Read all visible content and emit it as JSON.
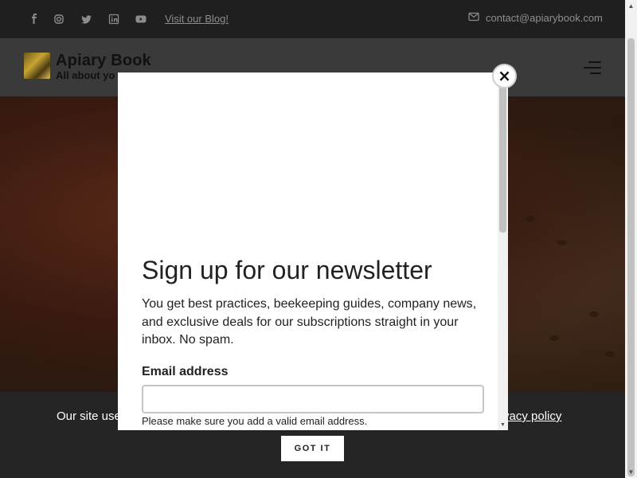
{
  "topbar": {
    "social_icons": [
      "facebook-icon",
      "instagram-icon",
      "twitter-icon",
      "linkedin-icon",
      "youtube-icon"
    ],
    "blog_link": "Visit our Blog!",
    "contact_email": "contact@apiarybook.com"
  },
  "header": {
    "logo_title": "Apiary Book",
    "logo_tagline": "All about yo"
  },
  "modal": {
    "title": "Sign up for our newsletter",
    "body": "You get best practices, beekeeping guides, company news, and exclusive deals for our subscriptions straight in your inbox. No spam.",
    "email_label": "Email address",
    "email_value": "",
    "email_hint": "Please make sure you add a valid email address.",
    "close_label": "×"
  },
  "cookie": {
    "text": "Our site use",
    "link": "vacy policy",
    "button": "GOT IT"
  },
  "colors": {
    "topbar_bg": "#1f1f1f",
    "header_bg": "#3a3a3a",
    "cookie_bg": "#252525",
    "text_muted": "#8e8e8e"
  }
}
